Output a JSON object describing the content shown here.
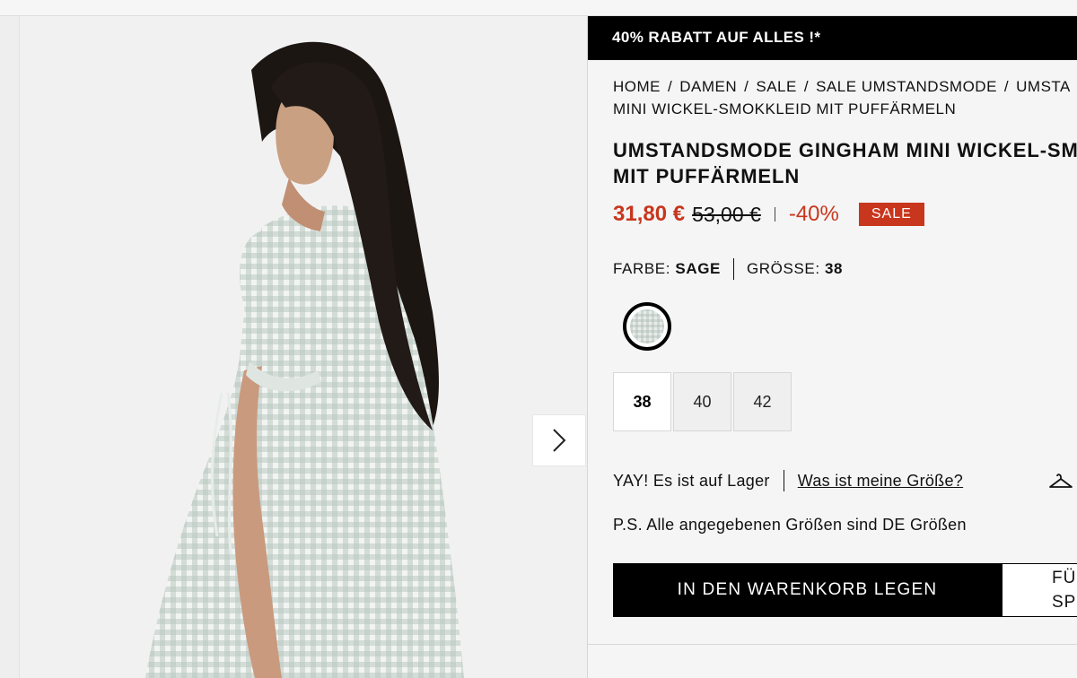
{
  "promo": {
    "text": "40% RABATT AUF ALLES !*"
  },
  "breadcrumb": {
    "items": [
      "HOME",
      "DAMEN",
      "SALE",
      "SALE UMSTANDSMODE",
      "UMSTA"
    ],
    "separator": "/",
    "line2": "MINI WICKEL-SMOKKLEID MIT PUFFÄRMELN"
  },
  "product": {
    "title_line1": "UMSTANDSMODE GINGHAM MINI WICKEL-SM",
    "title_line2": "MIT PUFFÄRMELN",
    "price_now": "31,80 €",
    "price_old": "53,00 €",
    "discount": "-40%",
    "sale_badge": "SALE",
    "price_color": "#c8361d"
  },
  "attributes": {
    "color_label": "FARBE:",
    "color_value": "SAGE",
    "size_label": "GRÖSSE:",
    "size_value": "38"
  },
  "sizes": [
    {
      "label": "38",
      "selected": true
    },
    {
      "label": "40",
      "selected": false
    },
    {
      "label": "42",
      "selected": false
    }
  ],
  "stock": {
    "text": "YAY! Es ist auf Lager",
    "size_link": "Was ist meine Größe?"
  },
  "note": "P.S. Alle angegebenen Größen sind DE Größen",
  "actions": {
    "add_to_cart": "IN DEN WARENKORB LEGEN",
    "wishlist_line1": "FÜ",
    "wishlist_line2": "SP"
  },
  "icons": {
    "next": "chevron-right-icon",
    "size_guide": "hanger-icon"
  }
}
